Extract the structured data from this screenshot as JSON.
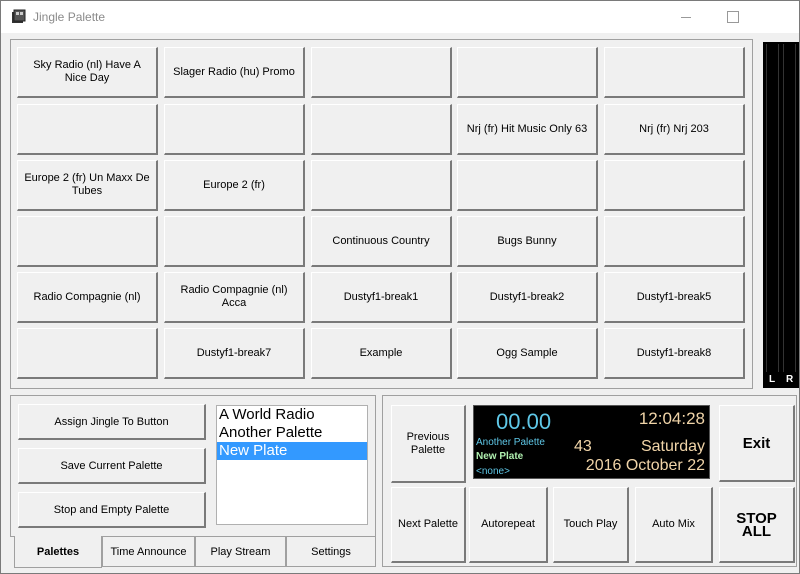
{
  "window": {
    "title": "Jingle Palette"
  },
  "jingles": [
    "Sky Radio (nl) Have A Nice Day",
    "Slager Radio (hu) Promo",
    "",
    "",
    "",
    "",
    "",
    "",
    "Nrj (fr) Hit Music Only 63",
    "Nrj (fr) Nrj 203",
    "Europe 2 (fr) Un Maxx De Tubes",
    "Europe 2 (fr)",
    "",
    "",
    "",
    "",
    "",
    "Continuous Country",
    "Bugs Bunny",
    "",
    "Radio Compagnie (nl)",
    "Radio Compagnie (nl) Acca",
    "Dustyf1-break1",
    "Dustyf1-break2",
    "Dustyf1-break5",
    "",
    "Dustyf1-break7",
    "Example",
    "Ogg Sample",
    "Dustyf1-break8"
  ],
  "vu": {
    "left_label": "L",
    "right_label": "R"
  },
  "palette_actions": {
    "assign": "Assign Jingle To Button",
    "save": "Save Current Palette",
    "stop_empty": "Stop and Empty Palette"
  },
  "palettes": {
    "items": [
      "A World Radio",
      "Another Palette",
      "New Plate"
    ],
    "selected": "New Plate"
  },
  "tabs": [
    "Palettes",
    "Time Announce",
    "Play Stream",
    "Settings"
  ],
  "controls": {
    "previous": "Previous Palette",
    "next": "Next Palette",
    "autorepeat": "Autorepeat",
    "touch_play": "Touch Play",
    "auto_mix": "Auto Mix",
    "exit": "Exit",
    "stop_all": "STOP ALL"
  },
  "clock": {
    "timer": "00.00",
    "time": "12:04:28",
    "previous_palette": "Another Palette",
    "current_palette": "New Plate",
    "next_palette": "<none>",
    "count": "43",
    "day": "Saturday",
    "date": "2016 October 22"
  },
  "colors": {
    "selection": "#3399ff",
    "display_bg": "#000000",
    "display_cyan": "#5fc8e8",
    "display_peach": "#f0d4a8",
    "display_green": "#b0f0b0"
  }
}
